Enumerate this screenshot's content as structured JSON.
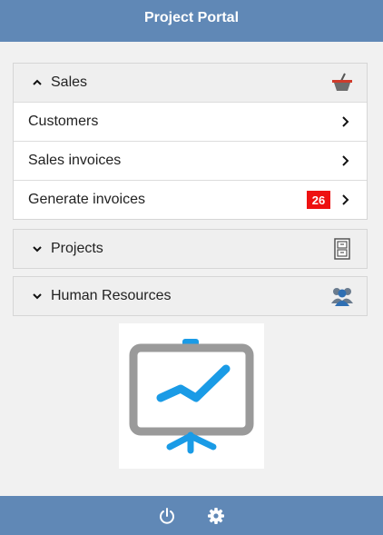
{
  "app": {
    "title": "Project Portal"
  },
  "menu": {
    "sales": {
      "label": "Sales",
      "icon": "shopping-basket-icon",
      "expanded": true,
      "items": [
        {
          "label": "Customers",
          "icon": "chevron-right-icon"
        },
        {
          "label": "Sales invoices",
          "icon": "chevron-right-icon"
        },
        {
          "label": "Generate invoices",
          "badge": "26",
          "icon": "chevron-right-icon"
        }
      ]
    },
    "projects": {
      "label": "Projects",
      "icon": "filing-cabinet-icon",
      "expanded": false
    },
    "hr": {
      "label": "Human Resources",
      "icon": "people-group-icon",
      "expanded": false
    }
  },
  "hero": {
    "icon": "presentation-chart-icon"
  },
  "footer": {
    "icons": [
      "power-icon",
      "gear-icon"
    ]
  },
  "colors": {
    "bar": "#6088b6",
    "badge": "#ee1111",
    "accent": "#1a9be6"
  }
}
